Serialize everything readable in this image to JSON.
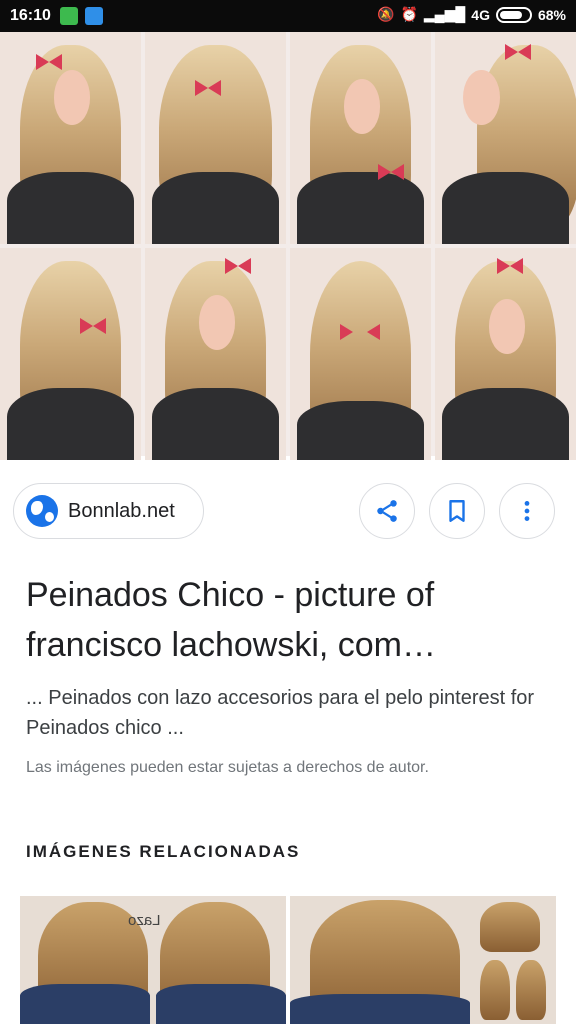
{
  "status_bar": {
    "time": "16:10",
    "network": "4G",
    "battery": "68%",
    "icons": [
      "app-green-icon",
      "app-blue-icon",
      "mute-icon",
      "alarm-icon",
      "signal-icon",
      "battery-icon"
    ]
  },
  "hero": {
    "thumbnails": [
      "hairstyle-photo-1",
      "hairstyle-photo-2",
      "hairstyle-photo-3",
      "hairstyle-photo-4",
      "hairstyle-photo-5",
      "hairstyle-photo-6",
      "hairstyle-photo-7",
      "hairstyle-photo-8"
    ]
  },
  "source": {
    "label": "Bonnlab.net",
    "icon": "globe-icon"
  },
  "actions": {
    "share_icon": "share-icon",
    "save_icon": "bookmark-icon",
    "more_icon": "more-vert-icon"
  },
  "result": {
    "title": "Peinados Chico - picture of francisco lachowski, com…",
    "snippet": "... Peinados con lazo accesorios para el pelo pinterest for Peinados chico ...",
    "copyright": "Las imágenes pueden estar sujetas a derechos de autor."
  },
  "related": {
    "heading": "IMÁGENES RELACIONADAS",
    "thumb_caption": "Lazo"
  },
  "colors": {
    "accent": "#1a73e8",
    "bow": "#d93b56",
    "border": "#dadce0"
  }
}
